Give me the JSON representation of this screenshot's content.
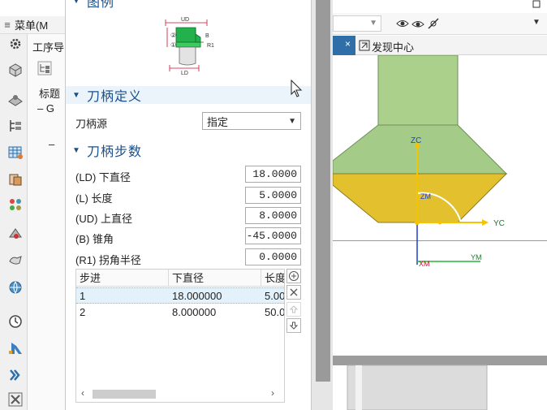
{
  "nav": {
    "menu_label": "菜单(M",
    "ops_label": "工序导",
    "title_label": "标题",
    "tree_dash": "– G",
    "tree_dash2": "–"
  },
  "dialog": {
    "legend_title": "图例",
    "legend_labels": {
      "ud": "UD",
      "b": "B",
      "r1": "R1",
      "ld": "LD",
      "two": "②",
      "one": "①"
    },
    "holder_def_title": "刀柄定义",
    "holder_source_label": "刀柄源",
    "holder_source_value": "指定",
    "holder_steps_title": "刀柄步数",
    "params": [
      {
        "label": "(LD) 下直径",
        "value": "18.0000"
      },
      {
        "label": "(L) 长度",
        "value": "5.0000"
      },
      {
        "label": "(UD) 上直径",
        "value": "8.0000"
      },
      {
        "label": "(B) 锥角",
        "value": "-45.0000"
      },
      {
        "label": "(R1) 拐角半径",
        "value": "0.0000"
      }
    ],
    "table": {
      "headers": [
        "步进",
        "下直径",
        "长度"
      ],
      "rows": [
        {
          "step": "1",
          "lower_diameter": "18.000000",
          "length": "5.00"
        },
        {
          "step": "2",
          "lower_diameter": "8.000000",
          "length": "50.0"
        }
      ]
    }
  },
  "graphics": {
    "tab_label": "发现中心",
    "axis_labels": {
      "zc": "ZC",
      "yc": "YC",
      "zm": "ZM",
      "xm": "XM",
      "ym": "YM"
    }
  },
  "colors": {
    "accent_blue": "#1b4f8a",
    "cone_green": "#a6cf8a",
    "cone_yellow": "#e3c12e"
  }
}
